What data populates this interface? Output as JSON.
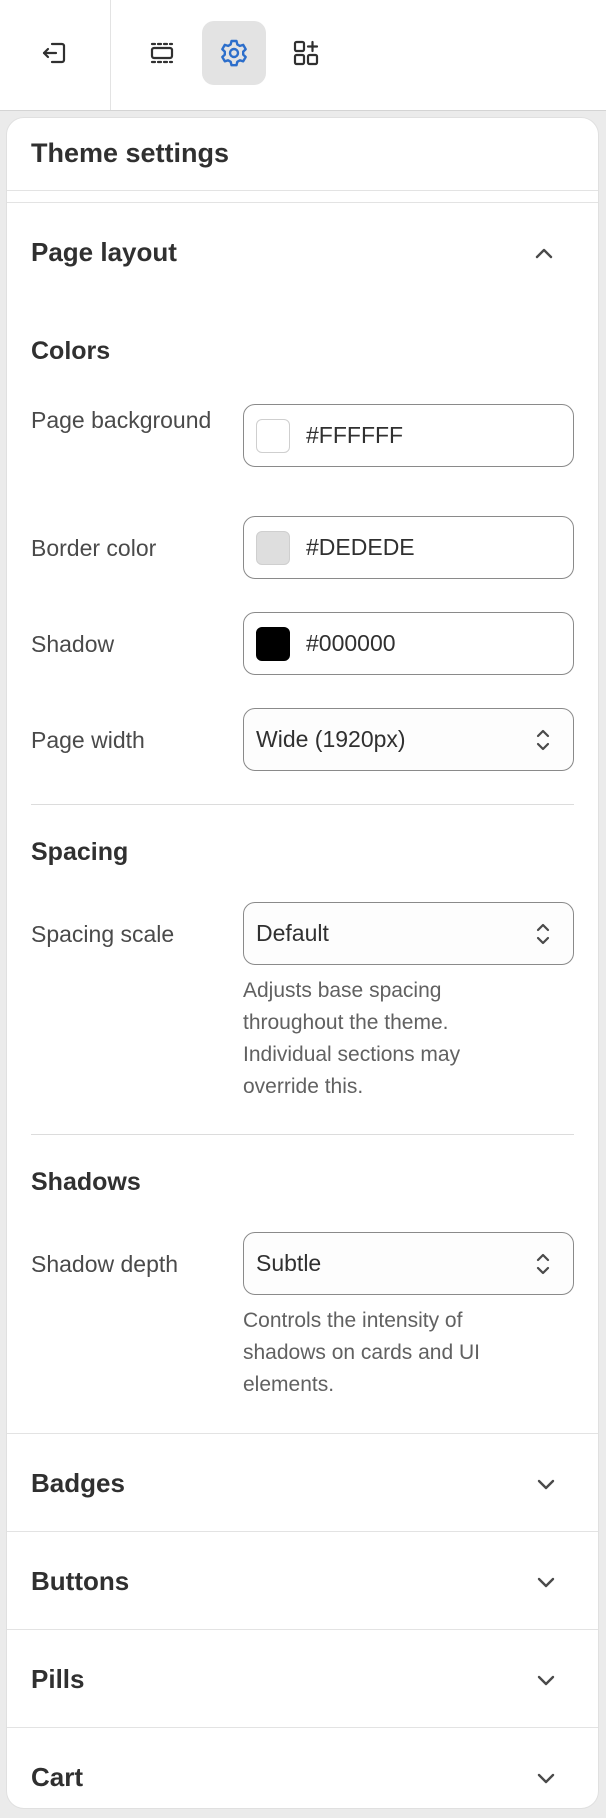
{
  "toolbar": {
    "exit_icon": "exit-icon",
    "sections_icon": "sections-icon",
    "settings_icon": "gear-icon",
    "apps_icon": "add-apps-icon",
    "active_color": "#2c6ecb"
  },
  "panel": {
    "title": "Theme settings"
  },
  "page_layout": {
    "title": "Page layout",
    "expanded": true,
    "colors": {
      "heading": "Colors",
      "page_background": {
        "label": "Page background",
        "value": "#FFFFFF",
        "swatch": "#FFFFFF"
      },
      "border_color": {
        "label": "Border color",
        "value": "#DEDEDE",
        "swatch": "#DEDEDE"
      },
      "shadow": {
        "label": "Shadow",
        "value": "#000000",
        "swatch": "#000000"
      },
      "page_width": {
        "label": "Page width",
        "value": "Wide (1920px)"
      }
    },
    "spacing": {
      "heading": "Spacing",
      "scale": {
        "label": "Spacing scale",
        "value": "Default"
      },
      "help": "Adjusts base spacing throughout the theme. Individual sections may override this."
    },
    "shadows": {
      "heading": "Shadows",
      "depth": {
        "label": "Shadow depth",
        "value": "Subtle"
      },
      "help": "Controls the intensity of shadows on cards and UI elements."
    }
  },
  "collapsed_sections": [
    {
      "title": "Badges"
    },
    {
      "title": "Buttons"
    },
    {
      "title": "Pills"
    },
    {
      "title": "Cart"
    }
  ]
}
